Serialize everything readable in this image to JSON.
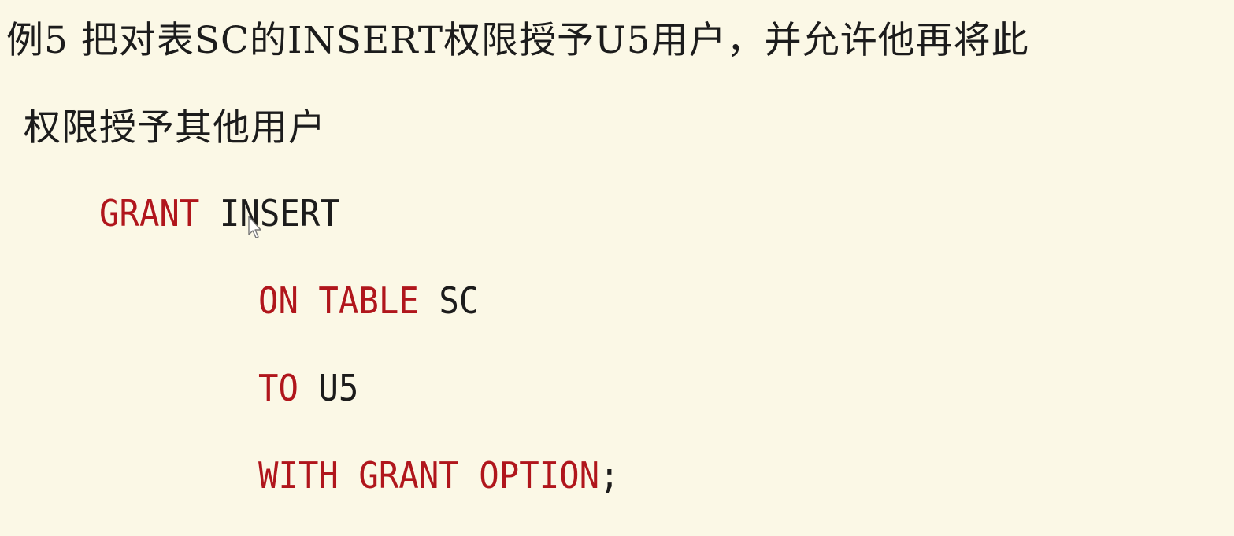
{
  "heading": {
    "line1": "例5 把对表SC的INSERT权限授予U5用户，并允许他再将此",
    "line2": "权限授予其他用户"
  },
  "code": {
    "line1": {
      "keyword": "GRANT",
      "rest": "INSERT"
    },
    "line2": {
      "keyword": "ON TABLE",
      "rest": "SC"
    },
    "line3": {
      "keyword": "TO",
      "rest": "U5"
    },
    "line4": {
      "keyword": "WITH GRANT OPTION",
      "rest": ";"
    }
  },
  "colors": {
    "background": "#fbf8e6",
    "keyword": "#b0161c",
    "text": "#1c1c1c"
  },
  "icons": {
    "cursor": "mouse-pointer-icon"
  }
}
